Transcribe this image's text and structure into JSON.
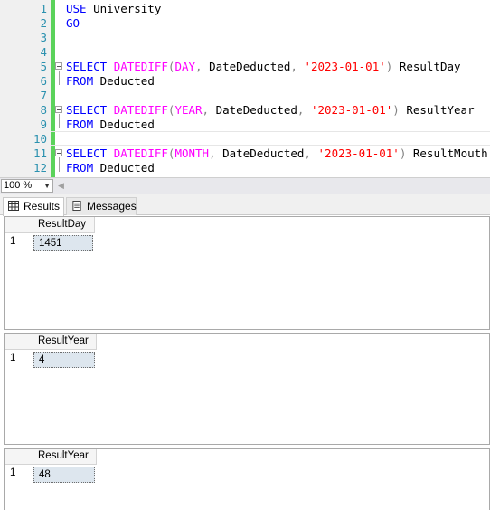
{
  "editor": {
    "lines": [
      {
        "num": "1",
        "parts": [
          {
            "t": "USE",
            "c": "kw"
          },
          {
            "t": " University",
            "c": "plain"
          }
        ]
      },
      {
        "num": "2",
        "parts": [
          {
            "t": "GO",
            "c": "kw"
          }
        ]
      },
      {
        "num": "3",
        "parts": []
      },
      {
        "num": "4",
        "parts": []
      },
      {
        "num": "5",
        "parts": [
          {
            "t": "SELECT",
            "c": "kw"
          },
          {
            "t": " ",
            "c": "plain"
          },
          {
            "t": "DATEDIFF",
            "c": "fn"
          },
          {
            "t": "(",
            "c": "gry"
          },
          {
            "t": "DAY",
            "c": "fn"
          },
          {
            "t": ",",
            "c": "gry"
          },
          {
            "t": " DateDeducted",
            "c": "plain"
          },
          {
            "t": ",",
            "c": "gry"
          },
          {
            "t": " ",
            "c": "plain"
          },
          {
            "t": "'2023-01-01'",
            "c": "str"
          },
          {
            "t": ")",
            "c": "gry"
          },
          {
            "t": " ResultDay",
            "c": "plain"
          }
        ]
      },
      {
        "num": "6",
        "parts": [
          {
            "t": "FROM",
            "c": "kw"
          },
          {
            "t": " Deducted",
            "c": "plain"
          }
        ]
      },
      {
        "num": "7",
        "parts": []
      },
      {
        "num": "8",
        "parts": [
          {
            "t": "SELECT",
            "c": "kw"
          },
          {
            "t": " ",
            "c": "plain"
          },
          {
            "t": "DATEDIFF",
            "c": "fn"
          },
          {
            "t": "(",
            "c": "gry"
          },
          {
            "t": "YEAR",
            "c": "fn"
          },
          {
            "t": ",",
            "c": "gry"
          },
          {
            "t": " DateDeducted",
            "c": "plain"
          },
          {
            "t": ",",
            "c": "gry"
          },
          {
            "t": " ",
            "c": "plain"
          },
          {
            "t": "'2023-01-01'",
            "c": "str"
          },
          {
            "t": ")",
            "c": "gry"
          },
          {
            "t": " ResultYear",
            "c": "plain"
          }
        ]
      },
      {
        "num": "9",
        "parts": [
          {
            "t": "FROM",
            "c": "kw"
          },
          {
            "t": " Deducted",
            "c": "plain"
          }
        ]
      },
      {
        "num": "10",
        "parts": []
      },
      {
        "num": "11",
        "parts": [
          {
            "t": "SELECT",
            "c": "kw"
          },
          {
            "t": " ",
            "c": "plain"
          },
          {
            "t": "DATEDIFF",
            "c": "fn"
          },
          {
            "t": "(",
            "c": "gry"
          },
          {
            "t": "MONTH",
            "c": "fn"
          },
          {
            "t": ",",
            "c": "gry"
          },
          {
            "t": " DateDeducted",
            "c": "plain"
          },
          {
            "t": ",",
            "c": "gry"
          },
          {
            "t": " ",
            "c": "plain"
          },
          {
            "t": "'2023-01-01'",
            "c": "str"
          },
          {
            "t": ")",
            "c": "gry"
          },
          {
            "t": " ResultMouth",
            "c": "plain"
          }
        ]
      },
      {
        "num": "12",
        "parts": [
          {
            "t": "FROM",
            "c": "kw"
          },
          {
            "t": " Deducted",
            "c": "plain"
          }
        ]
      }
    ],
    "colors": {
      "keyword": "#0000ff",
      "function": "#ff00ff",
      "string": "#ff0000",
      "operator": "#808080",
      "line_number": "#2b91af",
      "change_bar": "#5ad25a"
    }
  },
  "zoom": {
    "value": "100 %"
  },
  "tabs": {
    "results_label": "Results",
    "messages_label": "Messages"
  },
  "results": [
    {
      "column": "ResultDay",
      "row_number": "1",
      "value": "1451"
    },
    {
      "column": "ResultYear",
      "row_number": "1",
      "value": "4"
    },
    {
      "column": "ResultYear",
      "row_number": "1",
      "value": "48"
    }
  ]
}
